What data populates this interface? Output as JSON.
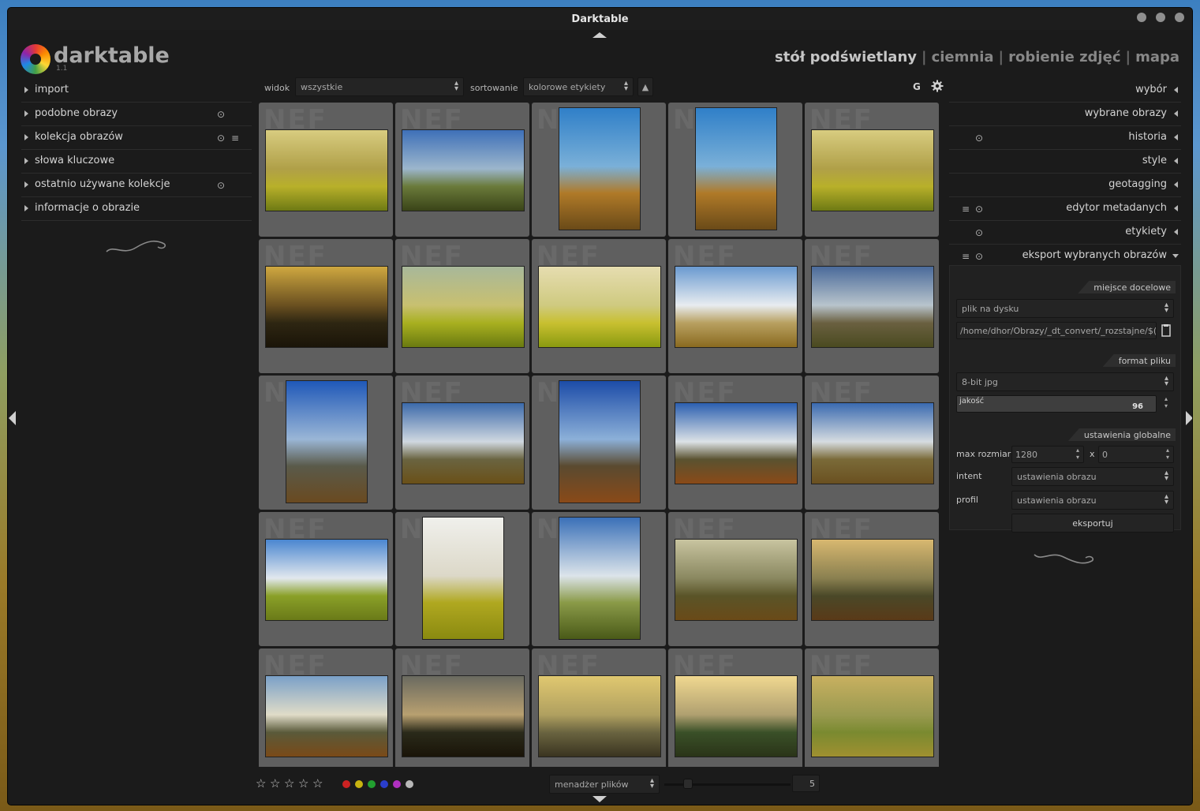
{
  "window": {
    "title": "Darktable"
  },
  "app": {
    "name": "darktable",
    "version": "1.1"
  },
  "views": {
    "active": "stół podświetlany",
    "others": [
      "ciemnia",
      "robienie zdjęć",
      "mapa"
    ],
    "separator": "|"
  },
  "left_panel": {
    "items": [
      {
        "label": "import"
      },
      {
        "label": "podobne obrazy",
        "reset": "⊙"
      },
      {
        "label": "kolekcja obrazów",
        "reset": "⊙",
        "presets": "≡"
      },
      {
        "label": "słowa kluczowe"
      },
      {
        "label": "ostatnio używane kolekcje",
        "reset": "⊙"
      },
      {
        "label": "informacje o obrazie"
      }
    ]
  },
  "top_toolbar": {
    "view_label": "widok",
    "view_value": "wszystkie",
    "sort_label": "sortowanie",
    "sort_value": "kolorowe etykiety",
    "sort_dir": "▲",
    "grouping": "G",
    "settings_icon": "gear-icon"
  },
  "grid": {
    "watermark": "NEF",
    "columns": 5,
    "rows": 5
  },
  "right_panel": {
    "items": [
      {
        "label": "wybór"
      },
      {
        "label": "wybrane obrazy"
      },
      {
        "label": "historia",
        "reset": "⊙"
      },
      {
        "label": "style"
      },
      {
        "label": "geotagging"
      },
      {
        "label": "edytor metadanych",
        "reset": "⊙",
        "presets": "≡"
      },
      {
        "label": "etykiety",
        "reset": "⊙"
      },
      {
        "label": "eksport wybranych obrazów",
        "reset": "⊙",
        "presets": "≡"
      }
    ]
  },
  "export": {
    "target_header": "miejsce docelowe",
    "target_value": "plik na dysku",
    "path": "/home/dhor/Obrazy/_dt_convert/_rozstajne/$(",
    "format_header": "format pliku",
    "format_value": "8-bit jpg",
    "quality_label": "jakość",
    "quality_value": "96",
    "global_header": "ustawienia globalne",
    "max_size_label": "max rozmiar",
    "width": "1280",
    "x": "x",
    "height": "0",
    "intent_label": "intent",
    "intent_value": "ustawienia obrazu",
    "profile_label": "profil",
    "profile_value": "ustawienia obrazu",
    "export_button": "eksportuj"
  },
  "bottom": {
    "stars": [
      "☆",
      "☆",
      "☆",
      "☆",
      "☆"
    ],
    "color_labels": [
      "#cc2222",
      "#c8b410",
      "#22a030",
      "#2a3ecc",
      "#b030c0",
      "#b8b8b8"
    ],
    "layout_value": "menadżer plików",
    "zoom": "5"
  }
}
